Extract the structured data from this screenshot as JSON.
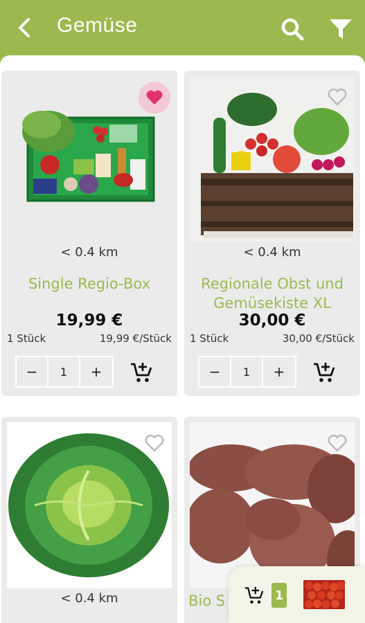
{
  "header": {
    "title": "Gemüse",
    "back_icon": "chevron-left-icon",
    "search_icon": "search-icon",
    "filter_icon": "filter-icon"
  },
  "products": [
    {
      "distance": "< 0.4 km",
      "name": "Single Regio-Box",
      "price": "19,99 €",
      "unit": "1 Stück",
      "unit_price": "19,99 €/Stück",
      "quantity": "1",
      "favorite": true
    },
    {
      "distance": "< 0.4 km",
      "name": "Regionale Obst und Gemüsekiste XL",
      "price": "30,00 €",
      "unit": "1 Stück",
      "unit_price": "30,00 €/Stück",
      "quantity": "1",
      "favorite": false
    },
    {
      "distance": "< 0.4 km",
      "favorite": false
    },
    {
      "name_partial": "Bio S",
      "favorite": false
    }
  ],
  "qty_controls": {
    "minus": "−",
    "plus": "+"
  },
  "cart": {
    "count": "1",
    "icon": "cart-icon"
  },
  "colors": {
    "accent": "#9bb94f",
    "favorite": "#e0336b",
    "card": "#ebebeb"
  }
}
